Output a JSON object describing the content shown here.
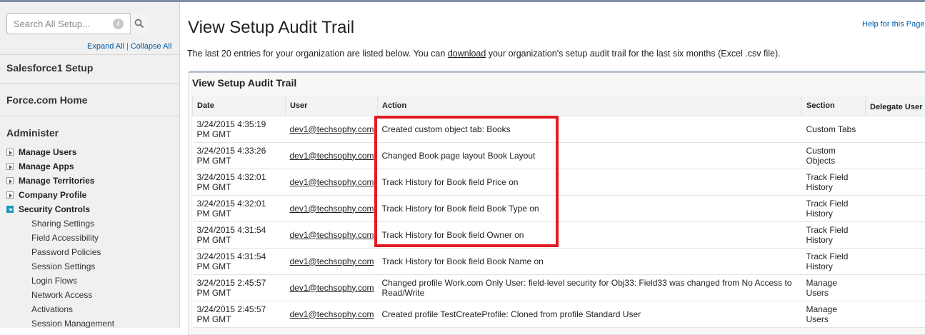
{
  "sidebar": {
    "search_placeholder": "Search All Setup...",
    "expand_all": "Expand All",
    "separator": "|",
    "collapse_all": "Collapse All",
    "sections": {
      "salesforce1": "Salesforce1 Setup",
      "force_home": "Force.com Home",
      "administer": "Administer"
    },
    "nav": [
      {
        "label": "Manage Users",
        "expanded": false
      },
      {
        "label": "Manage Apps",
        "expanded": false
      },
      {
        "label": "Manage Territories",
        "expanded": false
      },
      {
        "label": "Company Profile",
        "expanded": false
      },
      {
        "label": "Security Controls",
        "expanded": true
      }
    ],
    "security_sub": [
      "Sharing Settings",
      "Field Accessibility",
      "Password Policies",
      "Session Settings",
      "Login Flows",
      "Network Access",
      "Activations",
      "Session Management"
    ]
  },
  "main": {
    "title": "View Setup Audit Trail",
    "help_link": "Help for this Page",
    "intro_before": "The last 20 entries for your organization are listed below. You can ",
    "intro_link": "download",
    "intro_after": " your organization's setup audit trail for the last six months (Excel .csv file).",
    "panel_title": "View Setup Audit Trail",
    "columns": {
      "date": "Date",
      "user": "User",
      "action": "Action",
      "section": "Section",
      "delegate": "Delegate User"
    },
    "rows": [
      {
        "date": "3/24/2015 4:35:19 PM GMT",
        "user": "dev1@techsophy.com",
        "action": "Created custom object tab: Books",
        "section": "Custom Tabs"
      },
      {
        "date": "3/24/2015 4:33:26 PM GMT",
        "user": "dev1@techsophy.com",
        "action": "Changed Book page layout Book Layout",
        "section": "Custom Objects"
      },
      {
        "date": "3/24/2015 4:32:01 PM GMT",
        "user": "dev1@techsophy.com",
        "action": "Track History for Book field Price on",
        "section": "Track Field History"
      },
      {
        "date": "3/24/2015 4:32:01 PM GMT",
        "user": "dev1@techsophy.com",
        "action": "Track History for Book field Book Type on",
        "section": "Track Field History"
      },
      {
        "date": "3/24/2015 4:31:54 PM GMT",
        "user": "dev1@techsophy.com",
        "action": "Track History for Book field Owner on",
        "section": "Track Field History"
      },
      {
        "date": "3/24/2015 4:31:54 PM GMT",
        "user": "dev1@techsophy.com",
        "action": "Track History for Book field Book Name on",
        "section": "Track Field History"
      },
      {
        "date": "3/24/2015 2:45:57 PM GMT",
        "user": "dev1@techsophy.com",
        "action": "Changed profile Work.com Only User: field-level security for Obj33: Field33 was changed from No Access to Read/Write",
        "section": "Manage Users"
      },
      {
        "date": "3/24/2015 2:45:57 PM GMT",
        "user": "dev1@techsophy.com",
        "action": "Created profile TestCreateProfile: Cloned from profile Standard User",
        "section": "Manage Users"
      }
    ]
  },
  "colors": {
    "highlight": "#e11b22",
    "link": "#015ba7",
    "expanded_toggle": "#1797c0"
  },
  "icons": {
    "info": "info-icon",
    "search": "search-icon"
  }
}
